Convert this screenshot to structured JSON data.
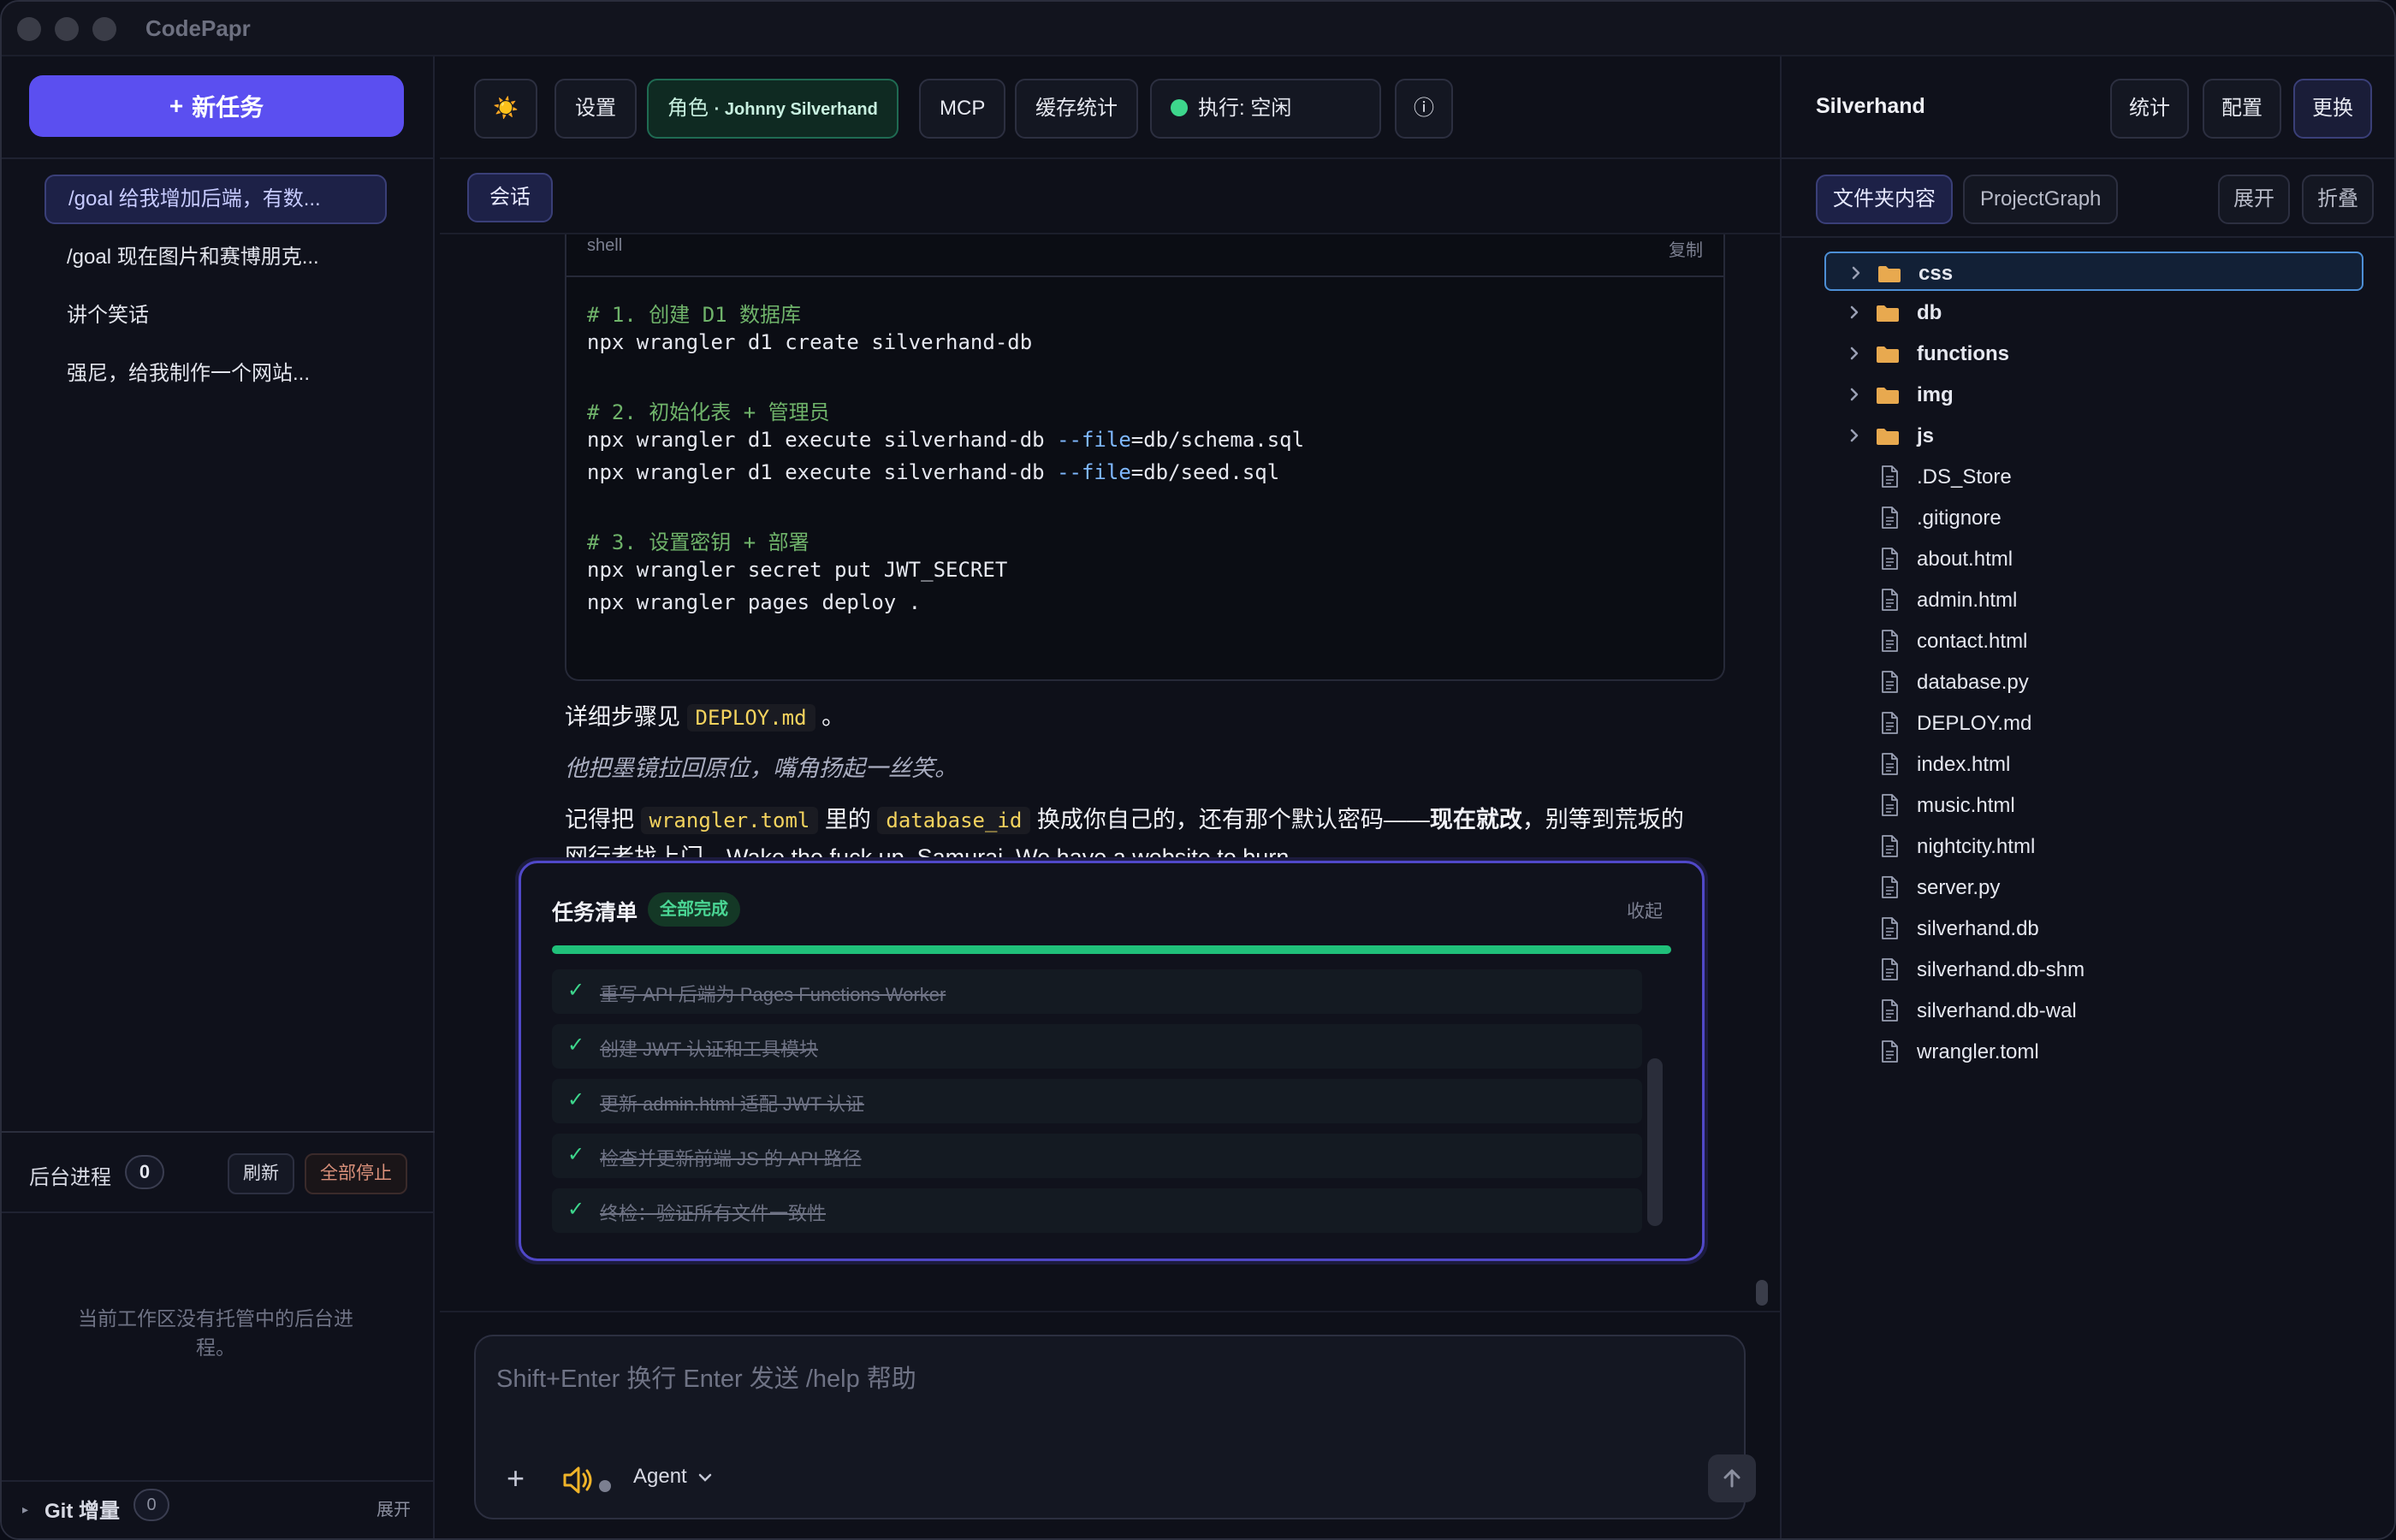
{
  "app": {
    "title": "CodePapr"
  },
  "sidebar": {
    "new_task": "新任务",
    "tasks": [
      {
        "label": "/goal 给我增加后端，有数..."
      },
      {
        "label": "/goal 现在图片和赛博朋克..."
      },
      {
        "label": "讲个笑话"
      },
      {
        "label": "强尼，给我制作一个网站..."
      }
    ],
    "background": {
      "title": "后台进程",
      "count": "0",
      "refresh": "刷新",
      "stop_all": "全部停止",
      "empty": "当前工作区没有托管中的后台进程。"
    },
    "git": {
      "title": "Git 增量",
      "count": "0",
      "expand": "展开"
    }
  },
  "toolbar": {
    "theme_icon": "☀️",
    "settings": "设置",
    "role_label": "角色",
    "role_name": "· Johnny Silverhand",
    "mcp": "MCP",
    "cache_stats": "缓存统计",
    "exec_label": "执行: 空闲",
    "info_icon": "ⓘ",
    "status_color": "#3dd68c"
  },
  "tabs": {
    "session": "会话"
  },
  "code": {
    "lang": "shell",
    "copy": "复制",
    "lines": [
      {
        "type": "comment",
        "text": "# 1. 创建 D1 数据库"
      },
      {
        "type": "code",
        "text": "npx wrangler d1 create silverhand-db"
      },
      {
        "type": "comment",
        "text": "# 2. 初始化表 + 管理员"
      },
      {
        "type": "code",
        "pre": "npx wrangler d1 execute silverhand-db ",
        "flag": "--file",
        "post": "=db/schema.sql"
      },
      {
        "type": "code",
        "pre": "npx wrangler d1 execute silverhand-db ",
        "flag": "--file",
        "post": "=db/seed.sql"
      },
      {
        "type": "comment",
        "text": "# 3. 设置密钥 + 部署"
      },
      {
        "type": "code",
        "text": "npx wrangler secret put JWT_SECRET"
      },
      {
        "type": "code",
        "text": "npx wrangler pages deploy ."
      }
    ]
  },
  "message": {
    "p1_pre": "详细步骤见",
    "p1_code": "DEPLOY.md",
    "p1_post": "。",
    "p2": "他把墨镜拉回原位，嘴角扬起一丝笑。",
    "p3_a": "记得把",
    "p3_code1": "wrangler.toml",
    "p3_b": "里的",
    "p3_code2": "database_id",
    "p3_c": "换成你自己的，还有那个默认密码——",
    "p3_bold": "现在就改",
    "p3_d": "，别等到荒坂的",
    "p3_line2": "网行者找上门。Wake the fuck up, Samurai. We have a website to burn."
  },
  "checklist": {
    "title": "任务清单",
    "badge": "全部完成",
    "collapse": "收起",
    "progress": 1.0,
    "items": [
      {
        "text": "重写 API 后端为 Pages Functions Worker"
      },
      {
        "text": "创建 JWT 认证和工具模块"
      },
      {
        "text": "更新 admin.html 适配 JWT 认证"
      },
      {
        "text": "检查并更新前端 JS 的 API 路径"
      },
      {
        "text": "终检：验证所有文件一致性"
      }
    ]
  },
  "composer": {
    "placeholder": "Shift+Enter 换行 Enter 发送 /help 帮助",
    "agent": "Agent"
  },
  "right": {
    "title": "Silverhand",
    "stats": "统计",
    "config": "配置",
    "change": "更换",
    "tab_files": "文件夹内容",
    "tab_graph": "ProjectGraph",
    "expand": "展开",
    "collapse": "折叠",
    "tree": [
      {
        "name": "css",
        "kind": "dir"
      },
      {
        "name": "db",
        "kind": "dir"
      },
      {
        "name": "functions",
        "kind": "dir"
      },
      {
        "name": "img",
        "kind": "dir"
      },
      {
        "name": "js",
        "kind": "dir"
      },
      {
        "name": ".DS_Store",
        "kind": "file"
      },
      {
        "name": ".gitignore",
        "kind": "file"
      },
      {
        "name": "about.html",
        "kind": "file"
      },
      {
        "name": "admin.html",
        "kind": "file"
      },
      {
        "name": "contact.html",
        "kind": "file"
      },
      {
        "name": "database.py",
        "kind": "file"
      },
      {
        "name": "DEPLOY.md",
        "kind": "file"
      },
      {
        "name": "index.html",
        "kind": "file"
      },
      {
        "name": "music.html",
        "kind": "file"
      },
      {
        "name": "nightcity.html",
        "kind": "file"
      },
      {
        "name": "server.py",
        "kind": "file"
      },
      {
        "name": "silverhand.db",
        "kind": "file"
      },
      {
        "name": "silverhand.db-shm",
        "kind": "file"
      },
      {
        "name": "silverhand.db-wal",
        "kind": "file"
      },
      {
        "name": "wrangler.toml",
        "kind": "file"
      }
    ]
  }
}
